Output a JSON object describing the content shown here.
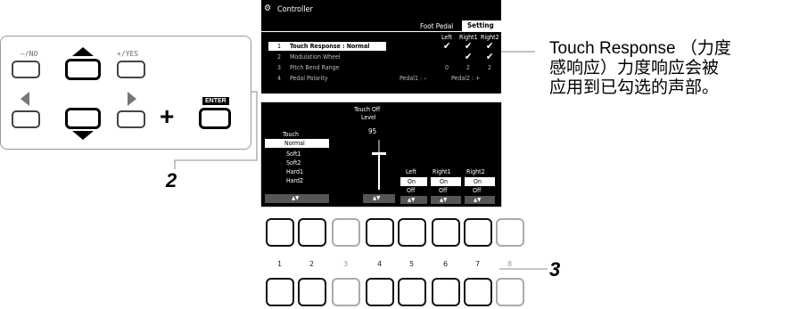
{
  "panel": {
    "no_label": "–/NO",
    "yes_label": "+/YES",
    "enter_label": "ENTER",
    "plus": "+",
    "step_label": "2"
  },
  "screen": {
    "title": "Controller",
    "tabs": [
      {
        "label": "Foot Pedal"
      },
      {
        "label": "Setting"
      }
    ],
    "col_headers": [
      "Left",
      "Right1",
      "Right2"
    ],
    "items": [
      {
        "num": "1",
        "label": "Touch Response : Normal",
        "vals": [
          "✔",
          "✔",
          "✔"
        ]
      },
      {
        "num": "2",
        "label": "Modulation Wheel",
        "vals": [
          "",
          "✔",
          "✔"
        ]
      },
      {
        "num": "3",
        "label": "Pitch Bend Range",
        "vals": [
          "0",
          "2",
          "2"
        ]
      },
      {
        "num": "4",
        "label": "Pedal Polarity",
        "extra1": "Pedal1 : –",
        "extra2": "Pedal2 : +"
      }
    ]
  },
  "touch": {
    "heading": "Touch",
    "options": [
      "Normal",
      "Soft1",
      "Soft2",
      "Hard1",
      "Hard2"
    ],
    "selected": "Normal",
    "touch_off_label_1": "Touch Off",
    "touch_off_label_2": "Level",
    "touch_off_value": "95",
    "touch_off_level_fraction": 0.74,
    "parts": [
      {
        "name": "Left",
        "on": "On",
        "off": "Off"
      },
      {
        "name": "Right1",
        "on": "On",
        "off": "Off"
      },
      {
        "name": "Right2",
        "on": "On",
        "off": "Off"
      }
    ],
    "arrows": "▲▼"
  },
  "buttons_row": {
    "numbers": [
      "1",
      "2",
      "3",
      "4",
      "5",
      "6",
      "7",
      "8"
    ],
    "step_label": "3"
  },
  "callout": {
    "line1": "Touch Response （力度",
    "line2": "感响应）力度响应会被",
    "line3": "应用到已勾选的声部。"
  }
}
